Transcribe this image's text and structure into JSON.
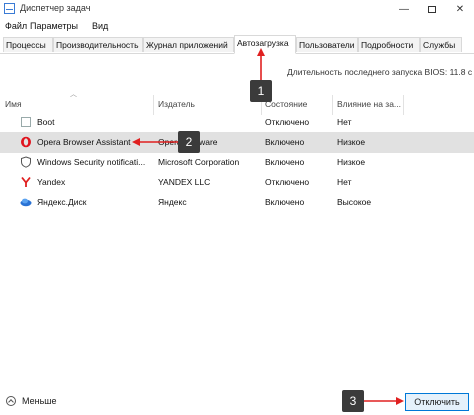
{
  "window": {
    "title": "Диспетчер задач"
  },
  "menu": [
    "Файл",
    "Параметры",
    "Вид"
  ],
  "tabs": [
    "Процессы",
    "Производительность",
    "Журнал приложений",
    "Автозагрузка",
    "Пользователи",
    "Подробности",
    "Службы"
  ],
  "active_tab": "Автозагрузка",
  "bios": "Длительность последнего запуска BIOS: 11.8 с",
  "columns": [
    "Имя",
    "Издатель",
    "Состояние",
    "Влияние на за..."
  ],
  "rows": [
    {
      "name": "Boot",
      "publisher": "",
      "status": "Отключено",
      "impact": "Нет",
      "icon": "blank-app-icon"
    },
    {
      "name": "Opera Browser Assistant",
      "publisher": "Opera Software",
      "status": "Включено",
      "impact": "Низкое",
      "icon": "opera-icon"
    },
    {
      "name": "Windows Security notificati...",
      "publisher": "Microsoft Corporation",
      "status": "Включено",
      "impact": "Низкое",
      "icon": "shield-icon"
    },
    {
      "name": "Yandex",
      "publisher": "YANDEX LLC",
      "status": "Отключено",
      "impact": "Нет",
      "icon": "yandex-icon"
    },
    {
      "name": "Яндекс.Диск",
      "publisher": "Яндекс",
      "status": "Включено",
      "impact": "Высокое",
      "icon": "yandex-disk-icon"
    }
  ],
  "callouts": [
    "1",
    "2",
    "3"
  ],
  "footer": {
    "fewer_label": "Меньше",
    "disable_label": "Отключить"
  },
  "colors": {
    "accent": "#0078d7",
    "callout": "#3b3b3b",
    "arrow": "#e02020",
    "selected_row": "#e1e1e1"
  }
}
